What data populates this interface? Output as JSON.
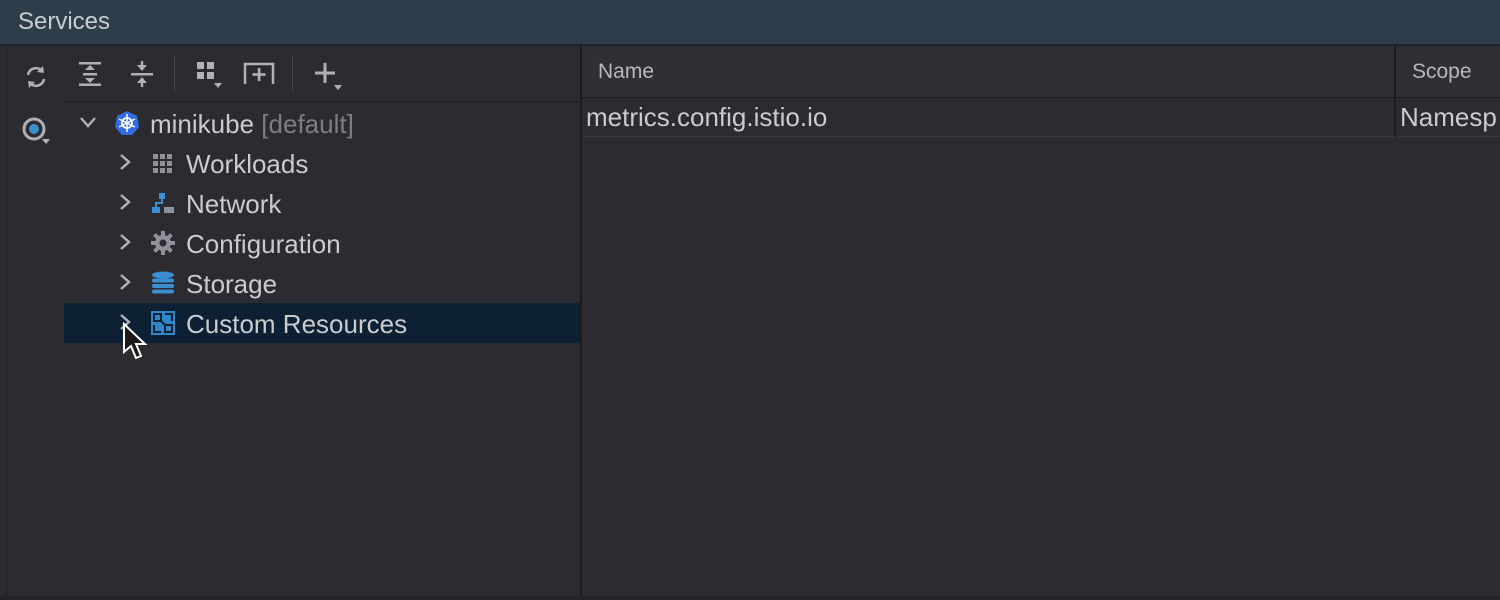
{
  "window": {
    "title": "Services"
  },
  "toolbar": {
    "buttons": [
      {
        "name": "expand-all-icon"
      },
      {
        "name": "collapse-all-icon"
      },
      {
        "name": "group-by-icon"
      },
      {
        "name": "new-tab-icon"
      },
      {
        "name": "add-service-icon"
      }
    ]
  },
  "sidebar": {
    "buttons": [
      {
        "name": "refresh-icon"
      },
      {
        "name": "filter-icon"
      }
    ]
  },
  "tree": {
    "root": {
      "label": "minikube",
      "context": "[default]",
      "icon": "kubernetes-icon",
      "expanded": true
    },
    "items": [
      {
        "label": "Workloads",
        "icon": "workloads-grid-icon"
      },
      {
        "label": "Network",
        "icon": "network-icon"
      },
      {
        "label": "Configuration",
        "icon": "gear-icon"
      },
      {
        "label": "Storage",
        "icon": "database-icon"
      },
      {
        "label": "Custom Resources",
        "icon": "custom-resources-icon",
        "selected": true
      }
    ]
  },
  "table": {
    "columns": [
      "Name",
      "Scope"
    ],
    "rows": [
      {
        "name": "metrics.config.istio.io",
        "scope": "Namesp"
      }
    ]
  },
  "colors": {
    "titlebar": "#2d3e4a",
    "panel": "#2b2b30",
    "selection": "#0d2034",
    "accent": "#3a8fd1"
  }
}
